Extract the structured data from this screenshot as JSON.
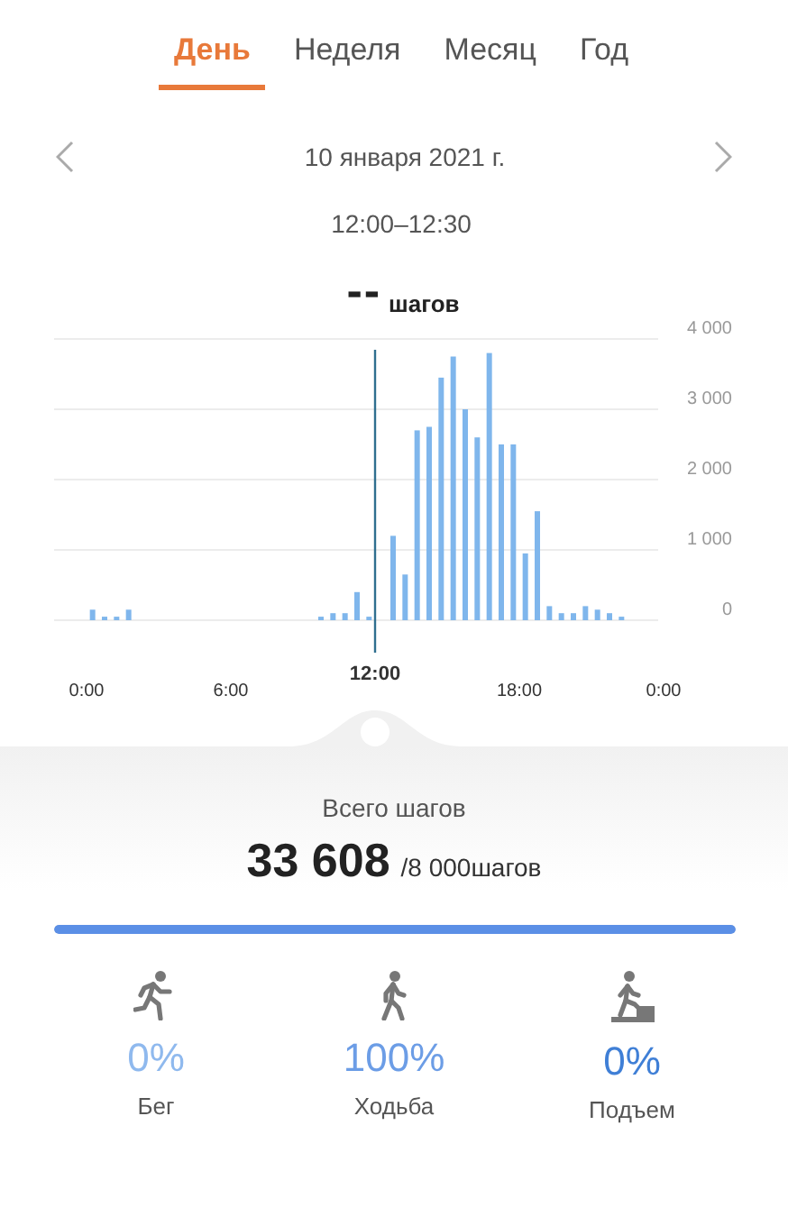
{
  "tabs": [
    {
      "label": "День",
      "selected": true
    },
    {
      "label": "Неделя",
      "selected": false
    },
    {
      "label": "Месяц",
      "selected": false
    },
    {
      "label": "Год",
      "selected": false
    }
  ],
  "date": "10 января 2021 г.",
  "time_range": "12:00–12:30",
  "selected_value": "--",
  "selected_unit": "шагов",
  "chart_data": {
    "type": "bar",
    "x": [
      0,
      0.5,
      1,
      1.5,
      9.5,
      10,
      10.5,
      11,
      11.5,
      12.5,
      13,
      13.5,
      14,
      14.5,
      15,
      15.5,
      16,
      16.5,
      17,
      17.5,
      18,
      18.5,
      19,
      19.5,
      20,
      20.5,
      21,
      21.5,
      22
    ],
    "values": [
      150,
      50,
      50,
      150,
      50,
      100,
      100,
      400,
      50,
      1200,
      650,
      2700,
      2750,
      3450,
      3750,
      3000,
      2600,
      3800,
      2500,
      2500,
      950,
      1550,
      200,
      100,
      100,
      200,
      150,
      100,
      50
    ],
    "grid": true,
    "ref_lines": [
      {
        "axis": "x",
        "value": 12
      }
    ],
    "xlim": [
      0,
      24
    ],
    "ylim": [
      0,
      4000
    ],
    "xticks": [
      {
        "value": 0,
        "label": "0:00"
      },
      {
        "value": 6,
        "label": "6:00"
      },
      {
        "value": 18,
        "label": "18:00"
      },
      {
        "value": 24,
        "label": "0:00"
      }
    ],
    "yticks": [
      {
        "value": 0,
        "label": "0"
      },
      {
        "value": 1000,
        "label": "1 000"
      },
      {
        "value": 2000,
        "label": "2 000"
      },
      {
        "value": 3000,
        "label": "3 000"
      },
      {
        "value": 4000,
        "label": "4 000"
      }
    ],
    "annotations": [
      "12:00"
    ]
  },
  "total_label": "Всего шагов",
  "total_value": "33 608",
  "goal": "/8 000шагов",
  "progress": {
    "level": 1
  },
  "activities": [
    {
      "kind": "run",
      "percent": "0%",
      "label": "Бег",
      "color": "#8fb9ee"
    },
    {
      "kind": "walk",
      "percent": "100%",
      "label": "Ходьба",
      "color": "#6c9de6"
    },
    {
      "kind": "climb",
      "percent": "0%",
      "label": "Подъем",
      "color": "#3f7fd6"
    }
  ]
}
